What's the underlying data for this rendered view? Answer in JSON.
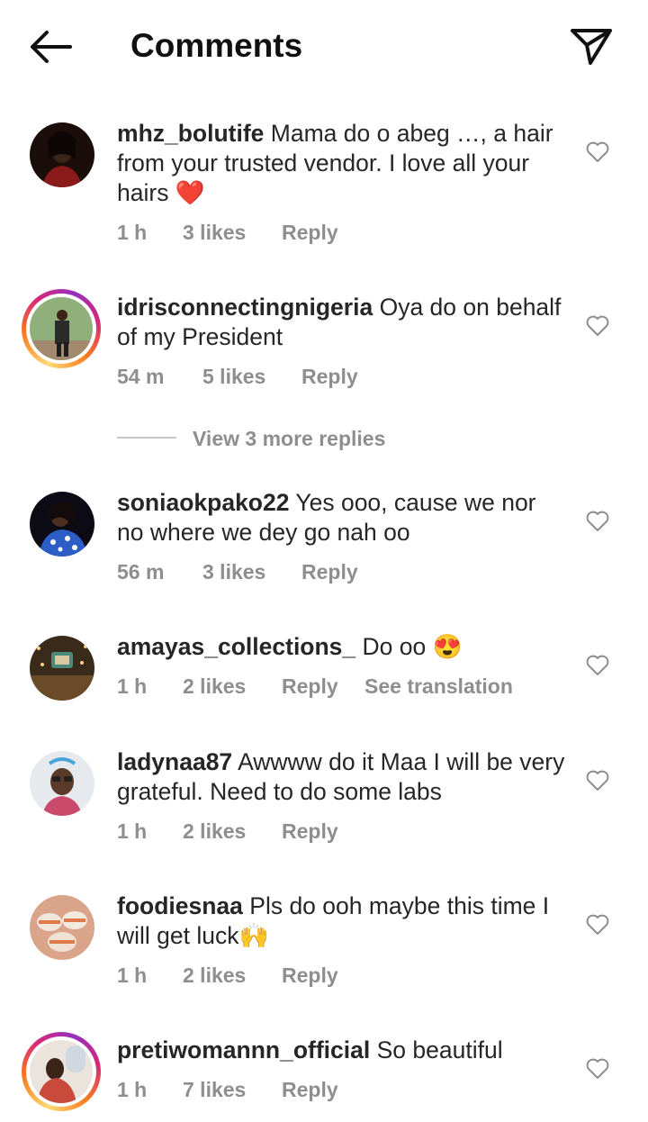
{
  "header": {
    "title": "Comments"
  },
  "comments": [
    {
      "user": "mhz_bolutife",
      "text": "Mama do o abeg …, a hair from your trusted vendor. I love all your hairs",
      "emoji": "❤️",
      "time": "1 h",
      "likes": "3 likes",
      "reply": "Reply"
    },
    {
      "user": "idrisconnectingnigeria",
      "text": "Oya do on behalf of my President",
      "time": "54 m",
      "likes": "5 likes",
      "reply": "Reply"
    },
    {
      "user": "soniaokpako22",
      "text": "Yes ooo, cause we nor no where we dey go nah oo",
      "time": "56 m",
      "likes": "3 likes",
      "reply": "Reply"
    },
    {
      "user": "amayas_collections_",
      "text": "Do oo",
      "emoji": "😍",
      "time": "1 h",
      "likes": "2 likes",
      "reply": "Reply",
      "translate": "See translation"
    },
    {
      "user": "ladynaa87",
      "text": "Awwww do it Maa I will be very grateful. Need to do some labs",
      "time": "1 h",
      "likes": "2 likes",
      "reply": "Reply"
    },
    {
      "user": "foodiesnaa",
      "text": "Pls do ooh maybe this time I will get luck",
      "emoji": "🙌",
      "time": "1 h",
      "likes": "2 likes",
      "reply": "Reply"
    },
    {
      "user": "pretiwomannn_official",
      "text": "So beautiful",
      "time": "1 h",
      "likes": "7 likes",
      "reply": "Reply"
    }
  ],
  "view_more_replies": "View 3 more replies",
  "icons": {
    "back": "arrow-left-icon",
    "send": "paper-plane-icon",
    "like": "heart-outline-icon"
  }
}
